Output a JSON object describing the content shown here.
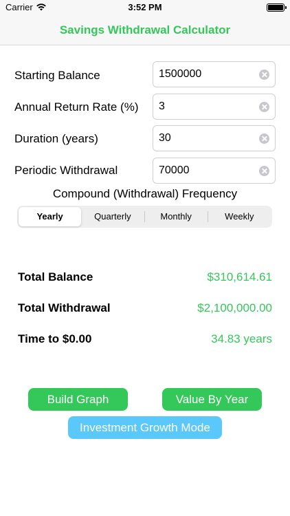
{
  "status_bar": {
    "carrier": "Carrier",
    "time": "3:52 PM",
    "icons": [
      "wifi-icon",
      "battery-icon"
    ]
  },
  "nav": {
    "title": "Savings Withdrawal Calculator"
  },
  "form": {
    "starting_balance": {
      "label": "Starting Balance",
      "value": "1500000"
    },
    "annual_return": {
      "label": "Annual Return Rate (%)",
      "value": "3"
    },
    "duration": {
      "label": "Duration (years)",
      "value": "30"
    },
    "withdrawal": {
      "label": "Periodic Withdrawal",
      "value": "70000"
    }
  },
  "frequency": {
    "label": "Compound (Withdrawal) Frequency",
    "options": [
      "Yearly",
      "Quarterly",
      "Monthly",
      "Weekly"
    ],
    "selected": "Yearly"
  },
  "results": {
    "total_balance": {
      "label": "Total Balance",
      "value": "$310,614.61"
    },
    "total_withdrawal": {
      "label": "Total Withdrawal",
      "value": "$2,100,000.00"
    },
    "time_to_zero": {
      "label": "Time to $0.00",
      "value": "34.83 years"
    }
  },
  "buttons": {
    "build_graph": "Build Graph",
    "value_by_year": "Value By Year",
    "investment_growth": "Investment Growth Mode"
  },
  "colors": {
    "accent_green": "#34c759",
    "accent_blue": "#5ac8fa"
  }
}
